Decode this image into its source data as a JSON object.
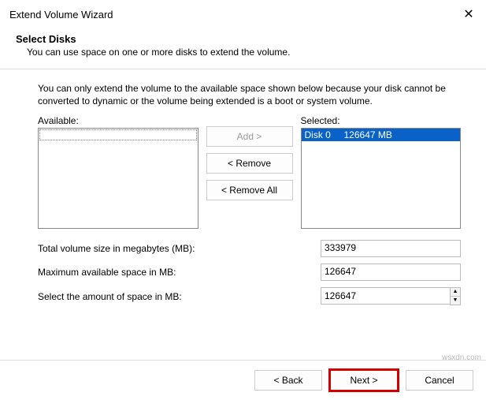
{
  "window": {
    "title": "Extend Volume Wizard"
  },
  "header": {
    "heading": "Select Disks",
    "subheading": "You can use space on one or more disks to extend the volume."
  },
  "body": {
    "info": "You can only extend the volume to the available space shown below because your disk cannot be converted to dynamic or the volume being extended is a boot or system volume.",
    "available_label": "Available:",
    "selected_label": "Selected:",
    "selected_items": [
      {
        "text": "Disk 0     126647 MB"
      }
    ],
    "buttons": {
      "add": "Add >",
      "remove": "< Remove",
      "remove_all": "< Remove All"
    },
    "rows": {
      "total_label": "Total volume size in megabytes (MB):",
      "total_value": "333979",
      "max_label": "Maximum available space in MB:",
      "max_value": "126647",
      "amount_label": "Select the amount of space in MB:",
      "amount_value": "126647"
    }
  },
  "footer": {
    "back": "< Back",
    "next": "Next >",
    "cancel": "Cancel"
  },
  "watermark": "wsxdn.com"
}
